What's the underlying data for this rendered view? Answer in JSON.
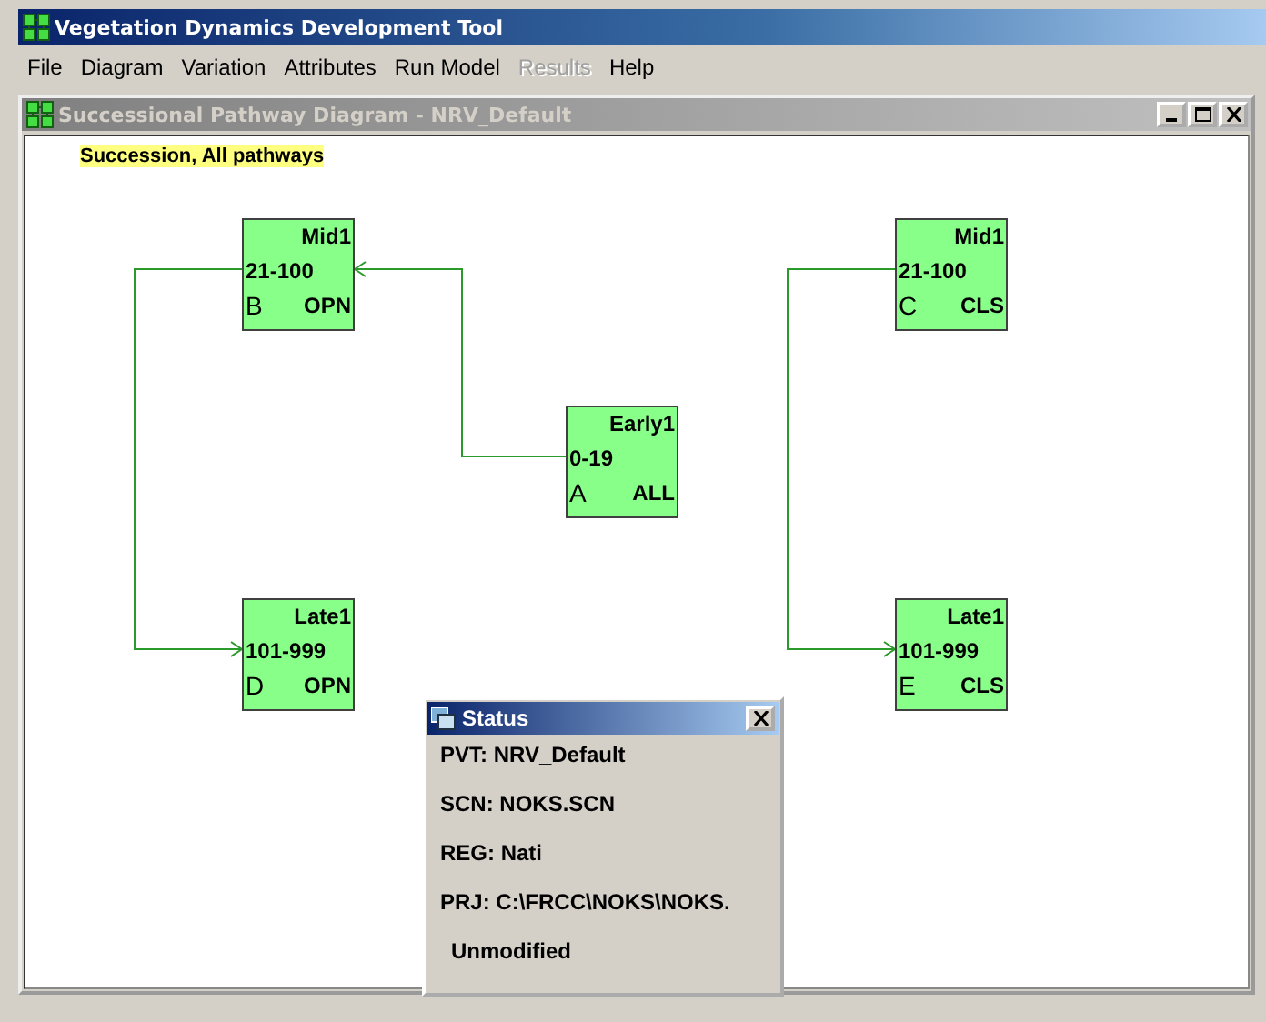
{
  "window": {
    "title": "Vegetation Dynamics Development Tool"
  },
  "menu": [
    {
      "label": "File",
      "disabled": false
    },
    {
      "label": "Diagram",
      "disabled": false
    },
    {
      "label": "Variation",
      "disabled": false
    },
    {
      "label": "Attributes",
      "disabled": false
    },
    {
      "label": "Run Model",
      "disabled": false
    },
    {
      "label": "Results",
      "disabled": true
    },
    {
      "label": "Help",
      "disabled": false
    }
  ],
  "diagram_window": {
    "title": "Successional Pathway Diagram - NRV_Default",
    "caption": "Succession, All pathways",
    "nodes": [
      {
        "name": "Mid1",
        "range": "21-100",
        "letter": "B",
        "code": "OPN"
      },
      {
        "name": "Early1",
        "range": "0-19",
        "letter": "A",
        "code": "ALL"
      },
      {
        "name": "Late1",
        "range": "101-999",
        "letter": "D",
        "code": "OPN"
      },
      {
        "name": "Mid1",
        "range": "21-100",
        "letter": "C",
        "code": "CLS"
      },
      {
        "name": "Late1",
        "range": "101-999",
        "letter": "E",
        "code": "CLS"
      }
    ]
  },
  "status": {
    "title": "Status",
    "lines": [
      "PVT: NRV_Default",
      "SCN: NOKS.SCN",
      "REG: Nati",
      "PRJ: C:\\FRCC\\NOKS\\NOKS."
    ],
    "state": "Unmodified"
  }
}
